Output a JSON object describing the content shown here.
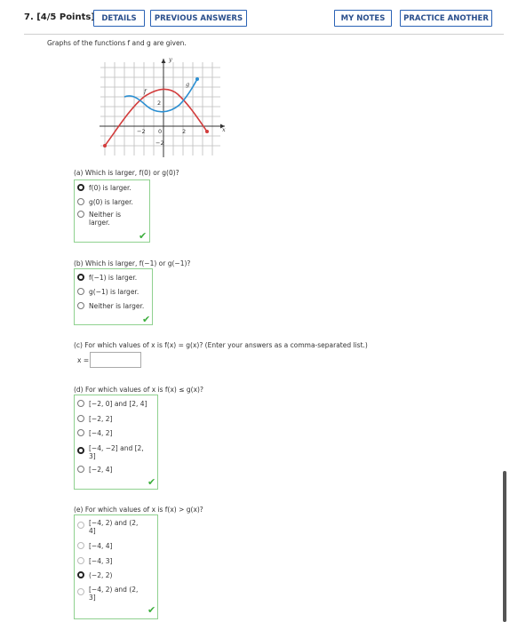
{
  "header": {
    "title": "7. [4/5 Points]",
    "details": "DETAILS",
    "previous_answers": "PREVIOUS ANSWERS",
    "my_notes": "MY NOTES",
    "practice_another": "PRACTICE ANOTHER"
  },
  "intro": "Graphs of the functions f and g are given.",
  "graph_labels": {
    "y": "y",
    "x": "x",
    "f": "f",
    "g": "g",
    "two_top": "2",
    "neg_two": "−2",
    "zero": "0",
    "two_right": "2",
    "neg_two_bottom": "−2"
  },
  "colors": {
    "f": "#d23c3c",
    "g": "#2b8fd2",
    "accent": "#2a62b5",
    "check": "#3cae3c"
  },
  "part_a": {
    "question": "(a) Which is larger, f(0) or g(0)?",
    "options": [
      "f(0) is larger.",
      "g(0) is larger.",
      "Neither is larger."
    ],
    "selected": 0
  },
  "part_b": {
    "question": "(b) Which is larger, f(−1) or g(−1)?",
    "options": [
      "f(−1) is larger.",
      "g(−1) is larger.",
      "Neither is larger."
    ],
    "selected": 0
  },
  "part_c": {
    "question": "(c) For which values of x is f(x) = g(x)? (Enter your answers as a comma-separated list.)",
    "input_label": "x =",
    "input_value": ""
  },
  "part_d": {
    "question": "(d) For which values of x is f(x) ≤ g(x)?",
    "options": [
      "[−2, 0] and [2, 4]",
      "[−2, 2]",
      "[−4, 2]",
      "[−4, −2] and [2, 3]",
      "[−2, 4]"
    ],
    "selected": 3
  },
  "part_e": {
    "question": "(e) For which values of x is f(x) > g(x)?",
    "options": [
      "[−4, 2) and (2, 4]",
      "[−4, 4]",
      "[−4, 3]",
      "(−2, 2)",
      "[−4, 2) and (2, 3]"
    ],
    "selected": 3
  },
  "check_mark": "✔"
}
